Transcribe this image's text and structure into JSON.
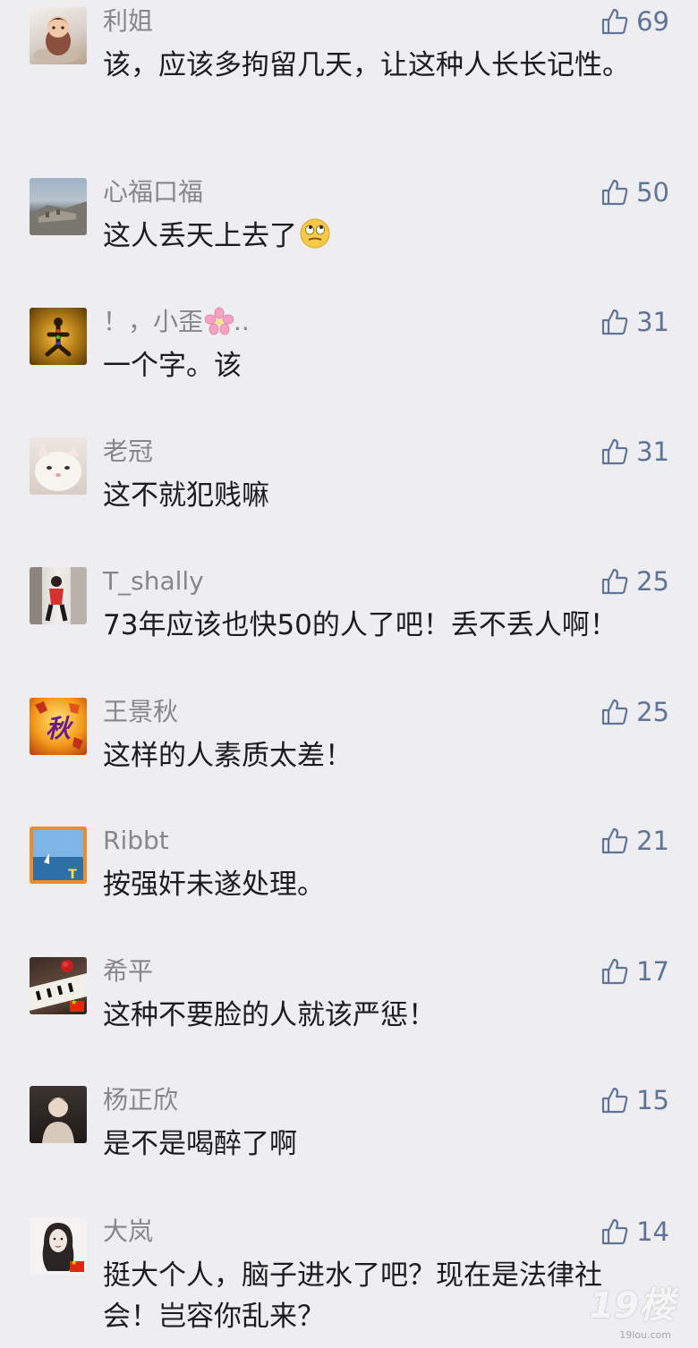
{
  "comments": [
    {
      "name": "利姐",
      "text": "该，应该多拘留几天，让这种人长长记性。",
      "likes": "69"
    },
    {
      "name": "心福口福",
      "text": "这人丢天上去了",
      "likes": "50",
      "emoji": "rolling-eyes-emoji"
    },
    {
      "name": "！，小歪",
      "name_suffix": "..",
      "name_icon": "cherry-blossom-emoji",
      "text": "一个字。该",
      "likes": "31"
    },
    {
      "name": "老冠",
      "text": "这不就犯贱嘛",
      "likes": "31"
    },
    {
      "name": "T_shally",
      "text": "73年应该也快50的人了吧！丢不丢人啊！",
      "likes": "25"
    },
    {
      "name": "王景秋",
      "text": "这样的人素质太差！",
      "likes": "25"
    },
    {
      "name": "Ribbt",
      "text": "按强奸未遂处理。",
      "likes": "21"
    },
    {
      "name": "希平",
      "text": "这种不要脸的人就该严惩！",
      "likes": "17"
    },
    {
      "name": "杨正欣",
      "text": "是不是喝醉了啊",
      "likes": "15"
    },
    {
      "name": "大岚",
      "text": "挺大个人，脑子进水了吧？现在是法律社会！岂容你乱来？",
      "likes": "14"
    }
  ],
  "watermark": {
    "main": "19楼",
    "sub": "19lou.com"
  },
  "colors": {
    "background": "#eeeef2",
    "name": "#878787",
    "text": "#1c1c1c",
    "like": "#5f7597"
  }
}
